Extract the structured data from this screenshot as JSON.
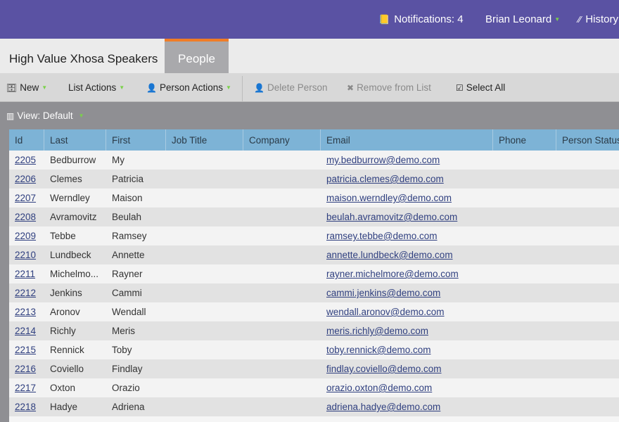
{
  "topbar": {
    "notifications": "Notifications: 4",
    "user": "Brian Leonard",
    "history": "History"
  },
  "tabs": {
    "list_title": "High Value Xhosa Speakers",
    "people": "People"
  },
  "toolbar": {
    "new": "New",
    "list_actions": "List Actions",
    "person_actions": "Person Actions",
    "delete_person": "Delete Person",
    "remove_from_list": "Remove from List",
    "select_all": "Select All"
  },
  "view": {
    "label": "View: Default"
  },
  "grid": {
    "columns": [
      "Id",
      "Last",
      "First",
      "Job Title",
      "Company",
      "Email",
      "Phone",
      "Person Status"
    ],
    "rows": [
      {
        "id": "2205",
        "last": "Bedburrow",
        "first": "My",
        "email": "my.bedburrow@demo.com"
      },
      {
        "id": "2206",
        "last": "Clemes",
        "first": "Patricia",
        "email": "patricia.clemes@demo.com"
      },
      {
        "id": "2207",
        "last": "Werndley",
        "first": "Maison",
        "email": "maison.werndley@demo.com"
      },
      {
        "id": "2208",
        "last": "Avramovitz",
        "first": "Beulah",
        "email": "beulah.avramovitz@demo.com"
      },
      {
        "id": "2209",
        "last": "Tebbe",
        "first": "Ramsey",
        "email": "ramsey.tebbe@demo.com"
      },
      {
        "id": "2210",
        "last": "Lundbeck",
        "first": "Annette",
        "email": "annette.lundbeck@demo.com"
      },
      {
        "id": "2211",
        "last": "Michelmo...",
        "first": "Rayner",
        "email": "rayner.michelmore@demo.com"
      },
      {
        "id": "2212",
        "last": "Jenkins",
        "first": "Cammi",
        "email": "cammi.jenkins@demo.com"
      },
      {
        "id": "2213",
        "last": "Aronov",
        "first": "Wendall",
        "email": "wendall.aronov@demo.com"
      },
      {
        "id": "2214",
        "last": "Richly",
        "first": "Meris",
        "email": "meris.richly@demo.com"
      },
      {
        "id": "2215",
        "last": "Rennick",
        "first": "Toby",
        "email": "toby.rennick@demo.com"
      },
      {
        "id": "2216",
        "last": "Coviello",
        "first": "Findlay",
        "email": "findlay.coviello@demo.com"
      },
      {
        "id": "2217",
        "last": "Oxton",
        "first": "Orazio",
        "email": "orazio.oxton@demo.com"
      },
      {
        "id": "2218",
        "last": "Hadye",
        "first": "Adriena",
        "email": "adriena.hadye@demo.com"
      }
    ]
  }
}
